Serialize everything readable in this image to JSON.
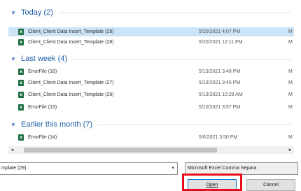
{
  "groups": [
    {
      "title": "Today (2)",
      "files": [
        {
          "name": "Client_Client Data Insert_Template (29)",
          "date": "5/20/2021 4:07 PM",
          "more": "M",
          "selected": true
        },
        {
          "name": "Client_Client Data Insert_Template (28)",
          "date": "5/20/2021 12:11 PM",
          "more": "M"
        }
      ]
    },
    {
      "title": "Last week (4)",
      "files": [
        {
          "name": "ErrorFile (16)",
          "date": "5/13/2021 3:48 PM",
          "more": "M"
        },
        {
          "name": "Client_Client Data Insert_Template (27)",
          "date": "5/13/2021 3:45 PM",
          "more": "M"
        },
        {
          "name": "Client_Client Data Insert_Template (26)",
          "date": "5/13/2021 10:28 AM",
          "more": "M"
        },
        {
          "name": "ErrorFile (15)",
          "date": "5/10/2021 3:57 PM",
          "more": "M"
        }
      ]
    },
    {
      "title": "Earlier this month (7)",
      "files": [
        {
          "name": "ErrorFile (14)",
          "date": "5/6/2021 3:50 PM",
          "more": "M"
        }
      ]
    }
  ],
  "icons": {
    "file": "excel-file-icon",
    "collapse": "chevron-down-icon"
  },
  "scroll": {
    "left": "◂",
    "right": "▸"
  },
  "filename": {
    "value": "mplate (29)"
  },
  "filetype": {
    "value": "Microsoft Excel Comma Separa"
  },
  "buttons": {
    "open": "Open",
    "cancel": "Cancel"
  },
  "colors": {
    "accent": "#1f5fa8",
    "highlight": "#e8101a",
    "selected": "#cce4f7",
    "excel": "#1d6f42"
  }
}
